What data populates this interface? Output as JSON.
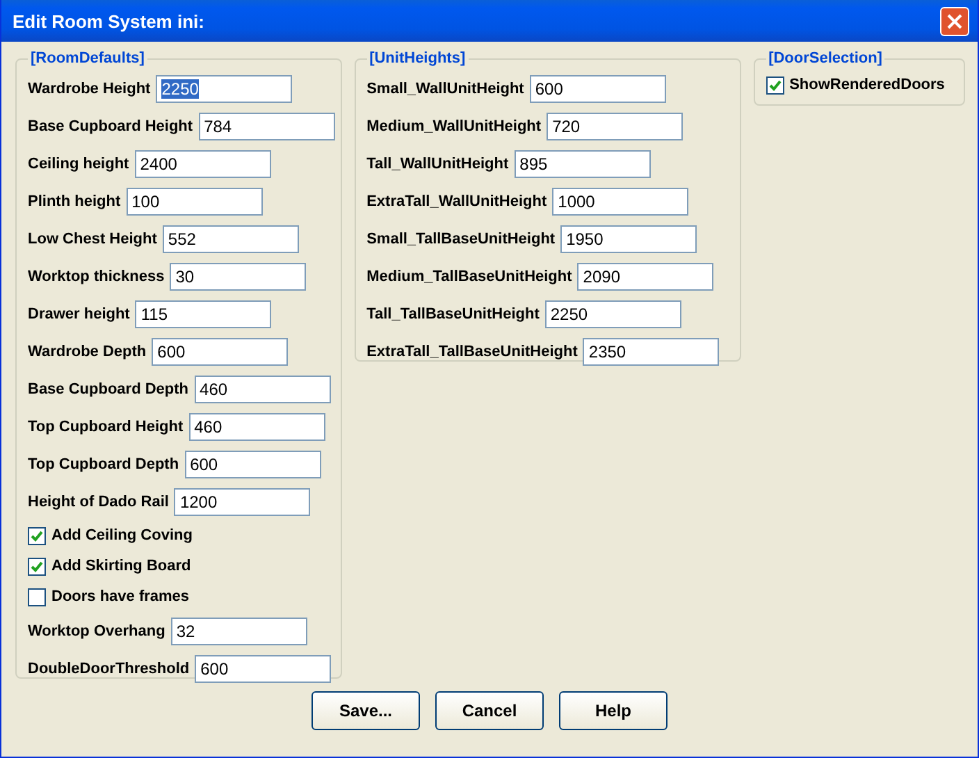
{
  "window": {
    "title": "Edit Room System ini:"
  },
  "groups": [
    {
      "title": "[RoomDefaults]",
      "items": [
        {
          "kind": "field",
          "label": "Wardrobe Height",
          "value": "2250",
          "selected": true
        },
        {
          "kind": "field",
          "label": "Base Cupboard Height",
          "value": "784",
          "selected": false
        },
        {
          "kind": "field",
          "label": "Ceiling height",
          "value": "2400",
          "selected": false
        },
        {
          "kind": "field",
          "label": "Plinth height",
          "value": "100",
          "selected": false
        },
        {
          "kind": "field",
          "label": "Low Chest Height",
          "value": "552",
          "selected": false
        },
        {
          "kind": "field",
          "label": "Worktop thickness",
          "value": "30",
          "selected": false
        },
        {
          "kind": "field",
          "label": "Drawer height",
          "value": "115",
          "selected": false
        },
        {
          "kind": "field",
          "label": "Wardrobe Depth",
          "value": "600",
          "selected": false
        },
        {
          "kind": "field",
          "label": "Base Cupboard Depth",
          "value": "460",
          "selected": false
        },
        {
          "kind": "field",
          "label": "Top Cupboard Height",
          "value": "460",
          "selected": false
        },
        {
          "kind": "field",
          "label": "Top Cupboard Depth",
          "value": "600",
          "selected": false
        },
        {
          "kind": "field",
          "label": "Height of Dado Rail",
          "value": "1200",
          "selected": false
        },
        {
          "kind": "checkbox",
          "label": "Add Ceiling Coving",
          "checked": true
        },
        {
          "kind": "checkbox",
          "label": "Add Skirting Board",
          "checked": true
        },
        {
          "kind": "checkbox",
          "label": "Doors have frames",
          "checked": false
        },
        {
          "kind": "field",
          "label": "Worktop Overhang",
          "value": "32",
          "selected": false
        },
        {
          "kind": "field",
          "label": "DoubleDoorThreshold",
          "value": "600",
          "selected": false
        }
      ]
    },
    {
      "title": "[UnitHeights]",
      "items": [
        {
          "kind": "field",
          "label": "Small_WallUnitHeight",
          "value": "600",
          "selected": false
        },
        {
          "kind": "field",
          "label": "Medium_WallUnitHeight",
          "value": "720",
          "selected": false
        },
        {
          "kind": "field",
          "label": "Tall_WallUnitHeight",
          "value": "895",
          "selected": false
        },
        {
          "kind": "field",
          "label": "ExtraTall_WallUnitHeight",
          "value": "1000",
          "selected": false
        },
        {
          "kind": "field",
          "label": "Small_TallBaseUnitHeight",
          "value": "1950",
          "selected": false
        },
        {
          "kind": "field",
          "label": "Medium_TallBaseUnitHeight",
          "value": "2090",
          "selected": false
        },
        {
          "kind": "field",
          "label": "Tall_TallBaseUnitHeight",
          "value": "2250",
          "selected": false
        },
        {
          "kind": "field",
          "label": "ExtraTall_TallBaseUnitHeight",
          "value": "2350",
          "selected": false
        }
      ]
    },
    {
      "title": "[DoorSelection]",
      "items": [
        {
          "kind": "checkbox",
          "label": "ShowRenderedDoors",
          "checked": true
        }
      ]
    }
  ],
  "buttons": [
    "Save...",
    "Cancel",
    "Help"
  ]
}
